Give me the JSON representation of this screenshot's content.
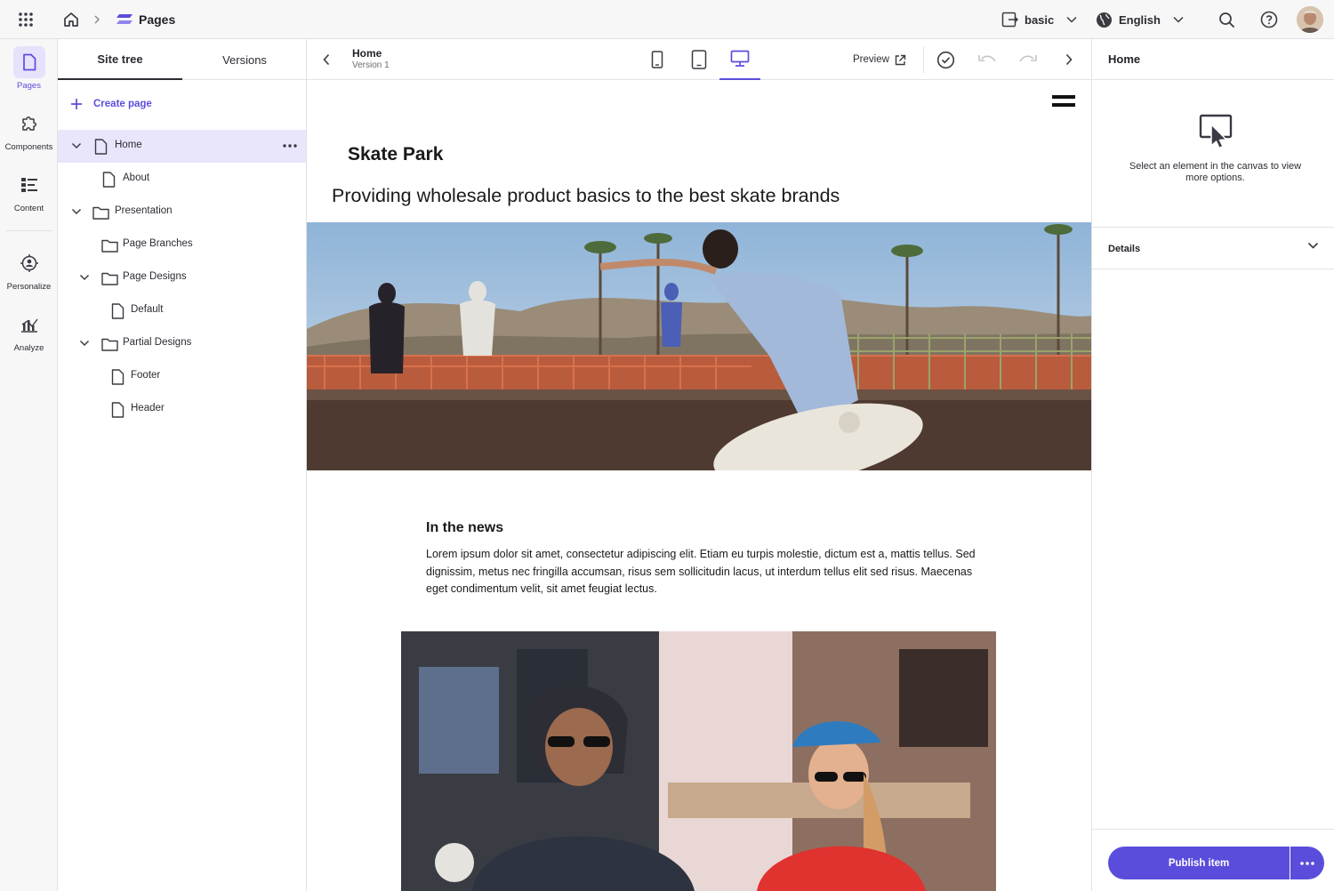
{
  "colors": {
    "accent": "#5b4ddb",
    "selected_row": "#e9e6fb",
    "border": "#e2e2e6"
  },
  "topbar": {
    "app_title": "Pages",
    "site_selector": "basic",
    "language_selector": "English",
    "icons": [
      "app-grid-icon",
      "home-icon",
      "chevron-right-icon",
      "pages-logo-icon",
      "site-switch-icon",
      "globe-icon",
      "search-icon",
      "help-icon"
    ]
  },
  "leftnav": {
    "items": [
      {
        "label": "Pages",
        "icon": "page-icon",
        "active": true
      },
      {
        "label": "Components",
        "icon": "puzzle-icon",
        "active": false
      },
      {
        "label": "Content",
        "icon": "content-list-icon",
        "active": false
      },
      {
        "label": "Personalize",
        "icon": "target-icon",
        "active": false
      },
      {
        "label": "Analyze",
        "icon": "analytics-icon",
        "active": false
      }
    ]
  },
  "tree": {
    "tabs": [
      {
        "label": "Site tree",
        "active": true
      },
      {
        "label": "Versions",
        "active": false
      }
    ],
    "create_label": "Create page",
    "items": [
      {
        "label": "Home",
        "type": "page",
        "expanded": true,
        "selected": true
      },
      {
        "label": "About",
        "type": "page"
      },
      {
        "label": "Presentation",
        "type": "folder",
        "expanded": true
      },
      {
        "label": "Page Branches",
        "type": "folder"
      },
      {
        "label": "Page Designs",
        "type": "folder",
        "expanded": true
      },
      {
        "label": "Default",
        "type": "page"
      },
      {
        "label": "Partial Designs",
        "type": "folder",
        "expanded": true
      },
      {
        "label": "Footer",
        "type": "page"
      },
      {
        "label": "Header",
        "type": "page"
      }
    ]
  },
  "canvas_header": {
    "title": "Home",
    "subtitle": "Version 1",
    "preview_label": "Preview",
    "devices": [
      "mobile",
      "tablet",
      "desktop"
    ],
    "active_device": "desktop"
  },
  "canvas": {
    "site_title": "Skate Park",
    "tagline": "Providing wholesale product basics to the best skate brands",
    "news_title": "In the news",
    "news_body": "Lorem ipsum dolor sit amet, consectetur adipiscing elit. Etiam eu turpis molestie, dictum est a, mattis tellus. Sed dignissim, metus nec fringilla accumsan, risus sem sollicitudin lacus, ut interdum tellus elit sed risus. Maecenas eget condimentum velit, sit amet feugiat lectus."
  },
  "rightpanel": {
    "title": "Home",
    "empty_message": "Select an element in the canvas to view more options.",
    "details_label": "Details",
    "publish_label": "Publish item"
  }
}
